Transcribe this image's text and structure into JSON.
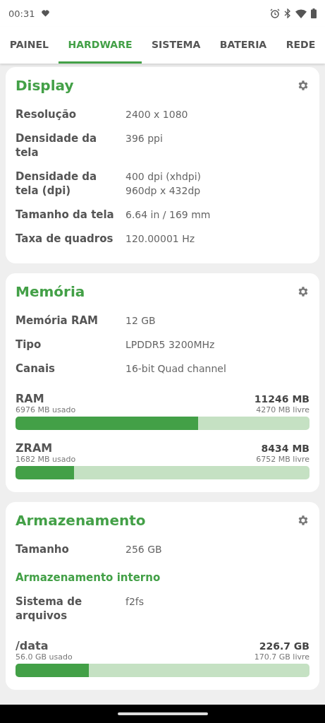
{
  "status_bar": {
    "time": "00:31"
  },
  "tabs": [
    {
      "label": "PAINEL",
      "selected": false
    },
    {
      "label": "HARDWARE",
      "selected": true
    },
    {
      "label": "SISTEMA",
      "selected": false
    },
    {
      "label": "BATERIA",
      "selected": false
    },
    {
      "label": "REDE",
      "selected": false
    }
  ],
  "cards": [
    {
      "title": "Display",
      "items": [
        {
          "kind": "row",
          "label": "Resolução",
          "values": [
            "2400 x 1080"
          ]
        },
        {
          "kind": "row",
          "label": "Densidade da tela",
          "values": [
            "396 ppi"
          ]
        },
        {
          "kind": "row",
          "label": "Densidade da tela (dpi)",
          "values": [
            "400 dpi (xhdpi)",
            "960dp x 432dp"
          ]
        },
        {
          "kind": "row",
          "label": "Tamanho da tela",
          "values": [
            "6.64 in / 169 mm"
          ]
        },
        {
          "kind": "row",
          "label": "Taxa de quadros",
          "values": [
            "120.00001 Hz"
          ]
        }
      ]
    },
    {
      "title": "Memória",
      "items": [
        {
          "kind": "row",
          "label": "Memória RAM",
          "values": [
            "12 GB"
          ]
        },
        {
          "kind": "row",
          "label": "Tipo",
          "values": [
            "LPDDR5 3200MHz"
          ]
        },
        {
          "kind": "row",
          "label": "Canais",
          "values": [
            "16-bit Quad channel"
          ]
        },
        {
          "kind": "bar",
          "label": "RAM",
          "total": "11246 MB",
          "used": "6976 MB usado",
          "free": "4270 MB livre",
          "level": 0.62
        },
        {
          "kind": "bar",
          "label": "ZRAM",
          "total": "8434 MB",
          "used": "1682 MB usado",
          "free": "6752 MB livre",
          "level": 0.2
        }
      ]
    },
    {
      "title": "Armazenamento",
      "items": [
        {
          "kind": "row",
          "label": "Tamanho",
          "values": [
            "256 GB"
          ]
        },
        {
          "kind": "subheading",
          "label": "Armazenamento interno"
        },
        {
          "kind": "row",
          "label": "Sistema de arquivos",
          "values": [
            "f2fs"
          ]
        },
        {
          "kind": "bar",
          "label": "/data",
          "total": "226.7 GB",
          "used": "56.0 GB usado",
          "free": "170.7 GB livre",
          "level": 0.25
        }
      ]
    }
  ]
}
